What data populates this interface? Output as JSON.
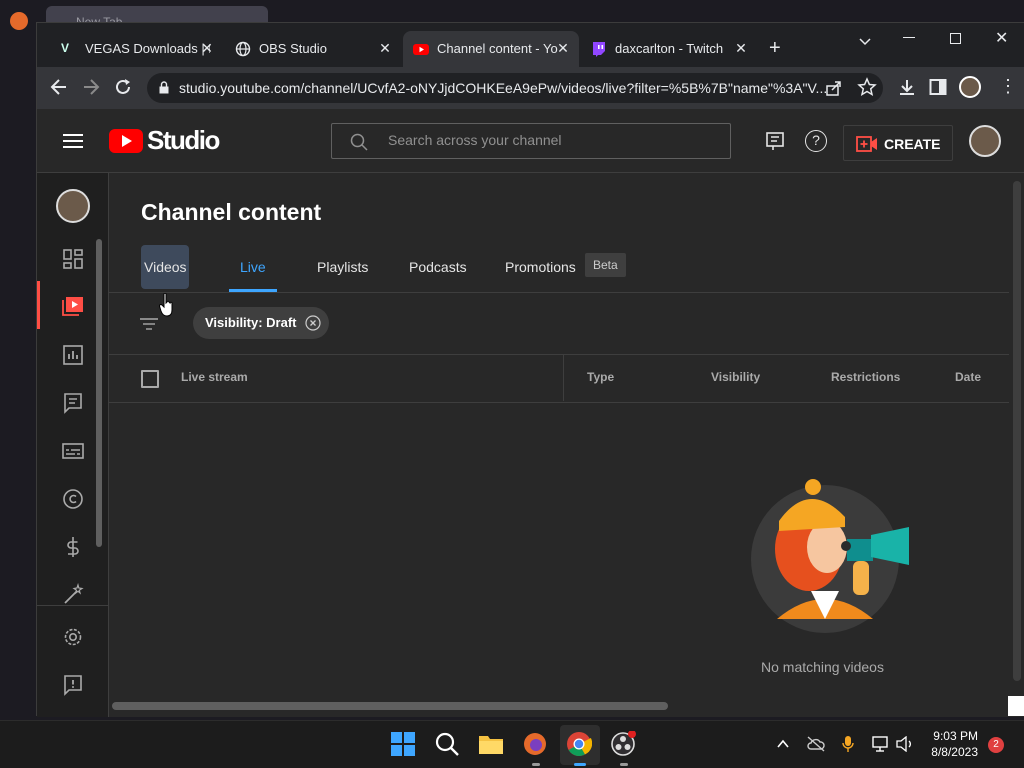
{
  "background_window": {
    "tab_label": "New Tab"
  },
  "browser": {
    "tabs": [
      {
        "label": "VEGAS Downloads | D",
        "favicon": "vegas-icon"
      },
      {
        "label": "OBS Studio",
        "favicon": "globe-icon"
      },
      {
        "label": "Channel content - Yo",
        "favicon": "youtube-icon"
      },
      {
        "label": "daxcarlton - Twitch",
        "favicon": "twitch-icon"
      }
    ],
    "url": "studio.youtube.com/channel/UCvfA2-oNYJjdCOHKEeA9ePw/videos/live?filter=%5B%7B\"name\"%3A\"V...",
    "new_tab": "+"
  },
  "studio": {
    "logo_text": "Studio",
    "search_placeholder": "Search across your channel",
    "create_label": "CREATE",
    "page_title": "Channel content",
    "tabs": [
      "Videos",
      "Live",
      "Playlists",
      "Podcasts",
      "Promotions"
    ],
    "active_tab": "Live",
    "beta_badge": "Beta",
    "filter_chip": "Visibility: Draft",
    "columns": [
      "Live stream",
      "Type",
      "Visibility",
      "Restrictions",
      "Date"
    ],
    "empty_message": "No matching videos",
    "accent_color": "#3ea6ff",
    "brand_red": "#ff0000"
  },
  "taskbar": {
    "time": "9:03 PM",
    "date": "8/8/2023",
    "notification_count": "2"
  }
}
